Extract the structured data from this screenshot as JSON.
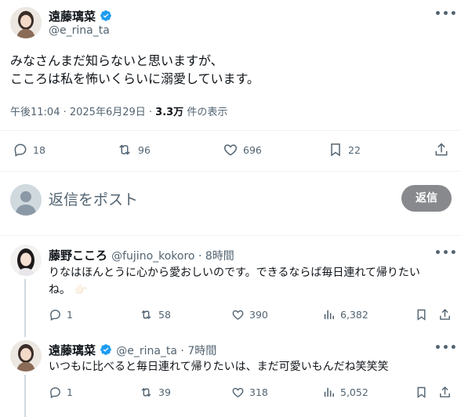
{
  "main_tweet": {
    "author_name": "遠藤璃菜",
    "author_handle": "@e_rina_ta",
    "text_line1": "みなさんまだ知らないと思いますが、",
    "text_line2": "こころは私を怖いくらいに溺愛しています。",
    "timestamp": "午後11:04 · 2025年6月29日 · ",
    "views_count": "3.3万",
    "views_label": " 件の表示",
    "actions": {
      "replies": "18",
      "retweets": "96",
      "likes": "696",
      "bookmarks": "22"
    }
  },
  "reply_box": {
    "placeholder": "返信をポスト",
    "button_label": "返信"
  },
  "replies": [
    {
      "author_name": "藤野こころ",
      "author_handle": "@fujino_kokoro",
      "time": " · 8時間",
      "text_line1": "りなはほんとうに心から愛おしいのです。できるならば毎日連れて帰りたい",
      "text_line2": "ね。",
      "emoji": "👉🏻",
      "actions": {
        "replies": "1",
        "retweets": "58",
        "likes": "390",
        "views": "6,382"
      }
    },
    {
      "author_name": "遠藤璃菜",
      "author_handle": "@e_rina_ta",
      "time": " · 7時間",
      "text_line1": "いつもに比べると毎日連れて帰りたいは、まだ可愛いもんだね笑笑笑",
      "actions": {
        "replies": "1",
        "retweets": "39",
        "likes": "318",
        "views": "5,052"
      }
    }
  ],
  "colors": {
    "text": "#0f1419",
    "muted": "#536471",
    "verified": "#1d9bf0",
    "divider": "#eff3f4",
    "reply_button": "#87898c"
  },
  "icons": [
    "verified-badge-icon",
    "more-icon",
    "reply-icon",
    "retweet-icon",
    "like-icon",
    "bookmark-icon",
    "share-icon",
    "views-icon",
    "default-avatar-icon"
  ]
}
